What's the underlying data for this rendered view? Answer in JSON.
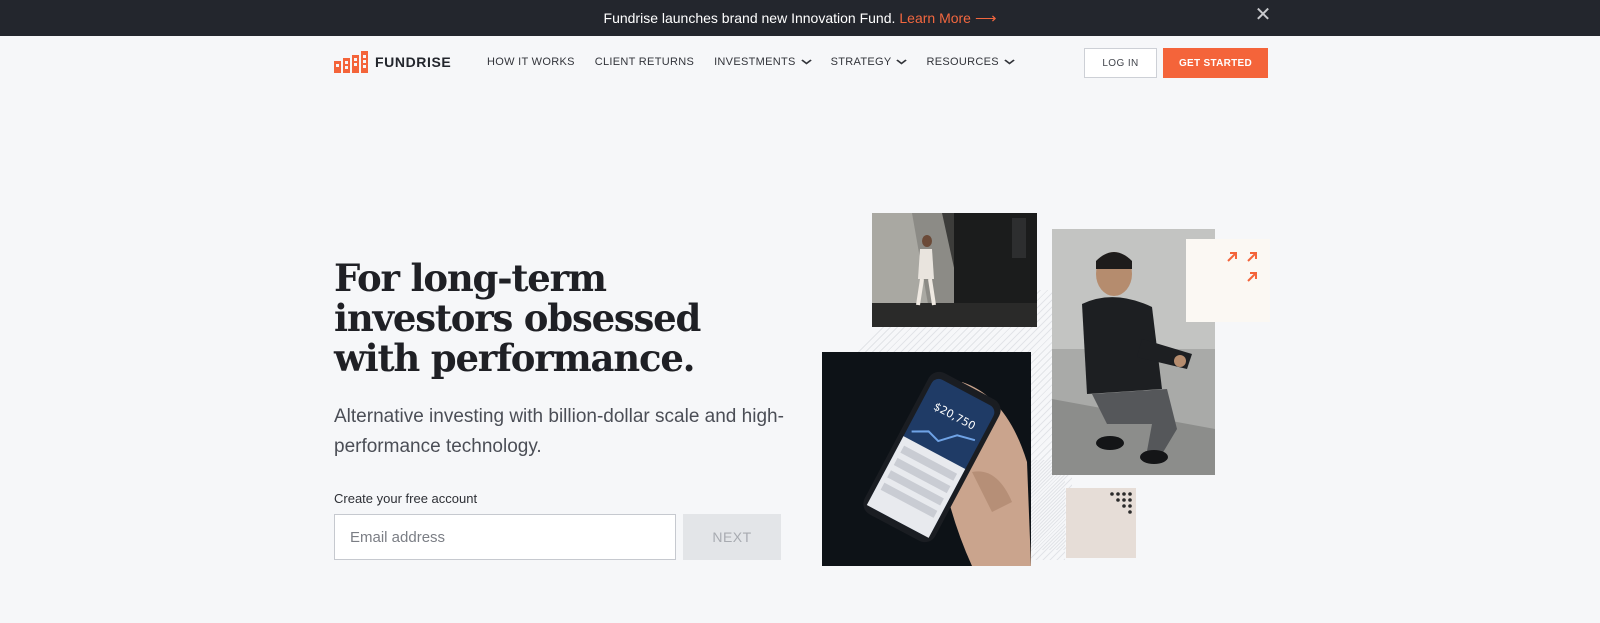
{
  "banner": {
    "message": "Fundrise launches brand new Innovation Fund.",
    "link_label": "Learn More",
    "arrow": "⟶",
    "close": "✕"
  },
  "nav": {
    "brand": "FUNDRISE",
    "items": [
      {
        "label": "HOW IT WORKS",
        "dropdown": false
      },
      {
        "label": "CLIENT RETURNS",
        "dropdown": false
      },
      {
        "label": "INVESTMENTS",
        "dropdown": true
      },
      {
        "label": "STRATEGY",
        "dropdown": true
      },
      {
        "label": "RESOURCES",
        "dropdown": true
      }
    ],
    "login_label": "LOG IN",
    "cta_label": "GET STARTED"
  },
  "hero": {
    "title": "For long-term investors obsessed with performance.",
    "subtitle": "Alternative investing with billion-dollar scale and high-performance technology.",
    "form_label": "Create your free account",
    "email_placeholder": "Email address",
    "next_label": "NEXT"
  },
  "colors": {
    "accent": "#f4643a",
    "banner_bg": "#23262d",
    "page_bg": "#f6f7f9"
  },
  "icons": {
    "logo": "building-bars-icon",
    "caret": "chevron-down-icon",
    "arrows": "diagonal-arrows-icon",
    "dots": "dot-grid-icon"
  }
}
